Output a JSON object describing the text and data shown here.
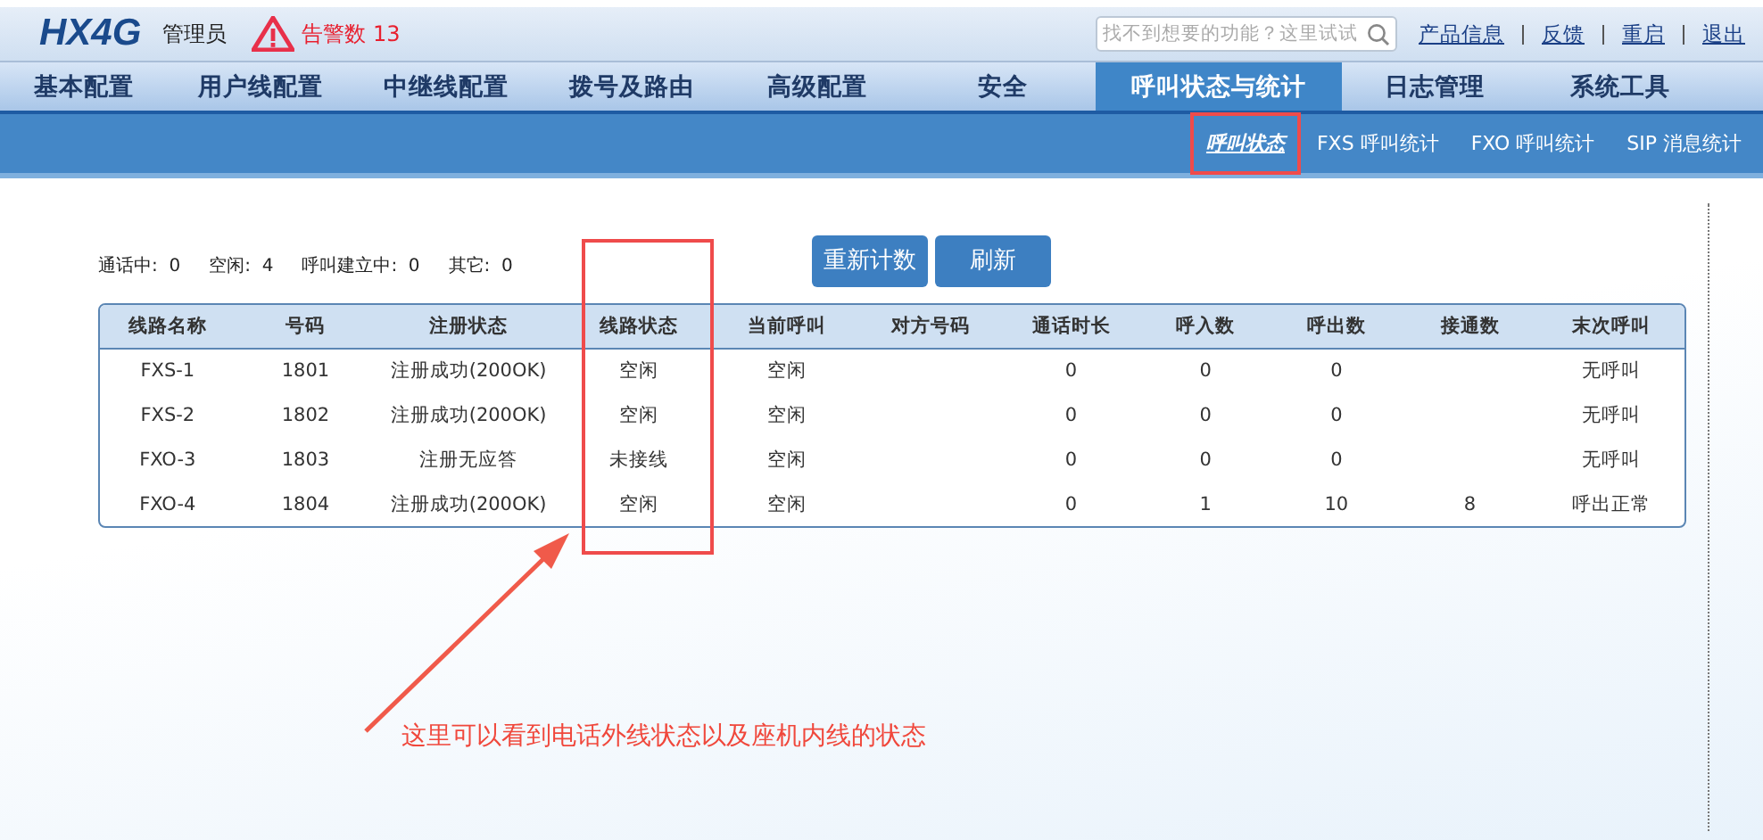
{
  "header": {
    "logo": "HX4G",
    "user": "管理员",
    "alarm": "告警数 13",
    "search": {
      "placeholder": "找不到想要的功能？这里试试"
    },
    "links": [
      "产品信息",
      "反馈",
      "重启",
      "退出"
    ]
  },
  "nav_tabs": [
    {
      "label": "基本配置",
      "selected": false
    },
    {
      "label": "用户线配置",
      "selected": false
    },
    {
      "label": "中继线配置",
      "selected": false
    },
    {
      "label": "拨号及路由",
      "selected": false
    },
    {
      "label": "高级配置",
      "selected": false
    },
    {
      "label": "安全",
      "selected": false
    },
    {
      "label": "呼叫状态与统计",
      "selected": true
    },
    {
      "label": "日志管理",
      "selected": false
    },
    {
      "label": "系统工具",
      "selected": false
    }
  ],
  "sub_tabs": [
    {
      "label": "呼叫状态",
      "selected": true
    },
    {
      "label": "FXS 呼叫统计",
      "selected": false
    },
    {
      "label": "FXO 呼叫统计",
      "selected": false
    },
    {
      "label": "SIP 消息统计",
      "selected": false
    }
  ],
  "stats": [
    {
      "label": "通话中:",
      "value": "0"
    },
    {
      "label": "空闲:",
      "value": "4"
    },
    {
      "label": "呼叫建立中:",
      "value": "0"
    },
    {
      "label": "其它:",
      "value": "0"
    }
  ],
  "buttons": [
    "重新计数",
    "刷新"
  ],
  "table": {
    "columns": [
      "线路名称",
      "号码",
      "注册状态",
      "线路状态",
      "当前呼叫",
      "对方号码",
      "通话时长",
      "呼入数",
      "呼出数",
      "接通数",
      "末次呼叫"
    ],
    "rows": [
      [
        "FXS-1",
        "1801",
        "注册成功(200OK)",
        "空闲",
        "空闲",
        "",
        "0",
        "0",
        "0",
        "",
        "无呼叫"
      ],
      [
        "FXS-2",
        "1802",
        "注册成功(200OK)",
        "空闲",
        "空闲",
        "",
        "0",
        "0",
        "0",
        "",
        "无呼叫"
      ],
      [
        "FXO-3",
        "1803",
        "注册无应答",
        "未接线",
        "空闲",
        "",
        "0",
        "0",
        "0",
        "",
        "无呼叫"
      ],
      [
        "FXO-4",
        "1804",
        "注册成功(200OK)",
        "空闲",
        "空闲",
        "",
        "0",
        "1",
        "10",
        "8",
        "呼出正常"
      ]
    ]
  },
  "annotation": {
    "text": "这里可以看到电话外线状态以及座机内线的状态"
  }
}
